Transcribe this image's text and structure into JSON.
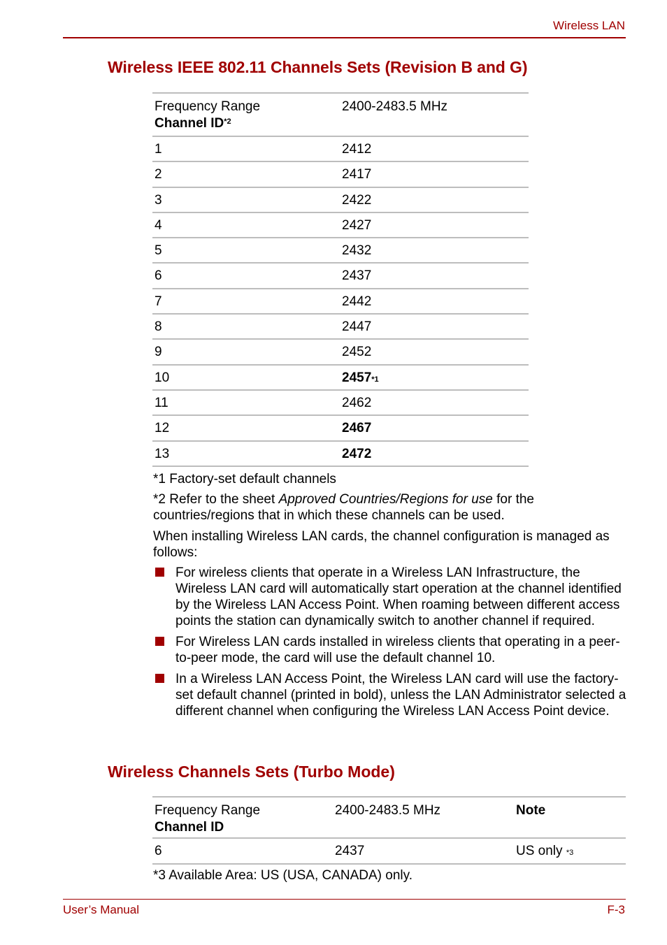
{
  "header": {
    "section_title": "Wireless LAN"
  },
  "section1": {
    "heading": "Wireless IEEE 802.11 Channels Sets (Revision B and G)",
    "table": {
      "header": {
        "col1_line1": "Frequency Range",
        "col1_line2": "Channel ID",
        "col1_sup": "*2",
        "col2": "2400-2483.5 MHz"
      },
      "rows": [
        {
          "channel": "1",
          "freq": "2412",
          "bold": false,
          "note": ""
        },
        {
          "channel": "2",
          "freq": "2417",
          "bold": false,
          "note": ""
        },
        {
          "channel": "3",
          "freq": "2422",
          "bold": false,
          "note": ""
        },
        {
          "channel": "4",
          "freq": "2427",
          "bold": false,
          "note": ""
        },
        {
          "channel": "5",
          "freq": "2432",
          "bold": false,
          "note": ""
        },
        {
          "channel": "6",
          "freq": "2437",
          "bold": false,
          "note": ""
        },
        {
          "channel": "7",
          "freq": "2442",
          "bold": false,
          "note": ""
        },
        {
          "channel": "8",
          "freq": "2447",
          "bold": false,
          "note": ""
        },
        {
          "channel": "9",
          "freq": "2452",
          "bold": false,
          "note": ""
        },
        {
          "channel": "10",
          "freq": "2457",
          "bold": true,
          "note": "*1"
        },
        {
          "channel": "11",
          "freq": "2462",
          "bold": false,
          "note": ""
        },
        {
          "channel": "12",
          "freq": "2467",
          "bold": true,
          "note": ""
        },
        {
          "channel": "13",
          "freq": "2472",
          "bold": true,
          "note": ""
        }
      ]
    },
    "footnote1": "*1 Factory-set default channels",
    "footnote2_pre": "*2 Refer to the sheet ",
    "footnote2_italic": "Approved Countries/Regions for use",
    "footnote2_post": " for the countries/regions that in which these channels can be used.",
    "intro": "When installing Wireless LAN cards, the channel configuration is managed as follows:",
    "bullets": [
      "For wireless clients that operate in a Wireless LAN Infrastructure, the Wireless LAN card will automatically start operation at the channel identified by the Wireless LAN Access Point. When roaming between different access points the station can dynamically switch to another channel if required.",
      "For Wireless LAN cards installed in wireless clients that operating in a peer-to-peer mode, the card will use the default channel 10.",
      "In a Wireless LAN Access Point, the Wireless LAN card will use the factory-set default channel (printed in bold), unless the LAN Administrator selected a different channel when configuring the Wireless LAN Access Point device."
    ]
  },
  "section2": {
    "heading": "Wireless Channels Sets (Turbo Mode)",
    "table": {
      "header": {
        "col1_line1": "Frequency Range",
        "col1_line2": "Channel ID",
        "col2": "2400-2483.5 MHz",
        "col3": "Note"
      },
      "rows": [
        {
          "channel": "6",
          "freq": "2437",
          "note": "US only ",
          "note_sup": "*3"
        }
      ]
    },
    "footnote3": "*3 Available Area: US (USA, CANADA) only."
  },
  "footer": {
    "left": "User’s Manual",
    "right": "F-3"
  },
  "colors": {
    "accent": "#a00000",
    "rule_gray": "#bdbdbd"
  }
}
